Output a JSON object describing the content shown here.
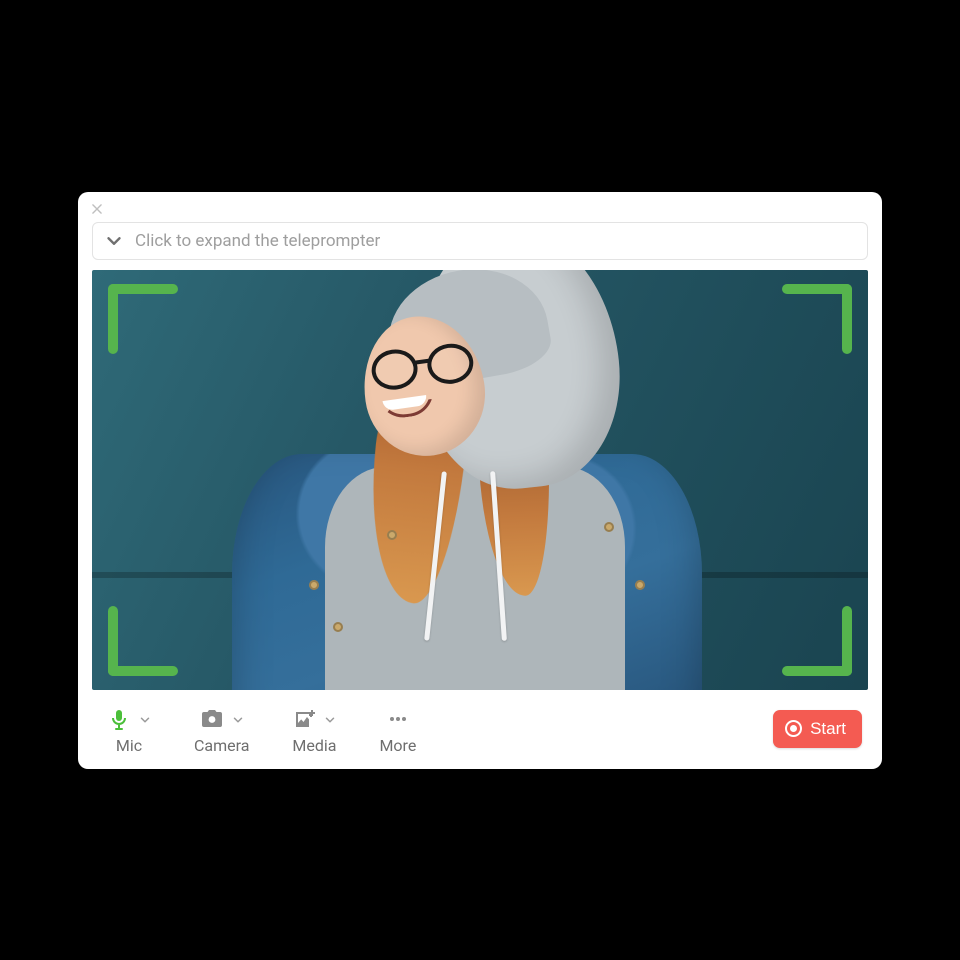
{
  "window": {
    "close_tooltip": "Close"
  },
  "teleprompter": {
    "placeholder": "Click to expand the teleprompter"
  },
  "toolbar": {
    "mic": {
      "label": "Mic"
    },
    "camera": {
      "label": "Camera"
    },
    "media": {
      "label": "Media"
    },
    "more": {
      "label": "More"
    },
    "start": {
      "label": "Start"
    }
  },
  "colors": {
    "accent_green": "#56b44d",
    "start_red": "#f45b52",
    "mic_green": "#4bbf3a"
  }
}
